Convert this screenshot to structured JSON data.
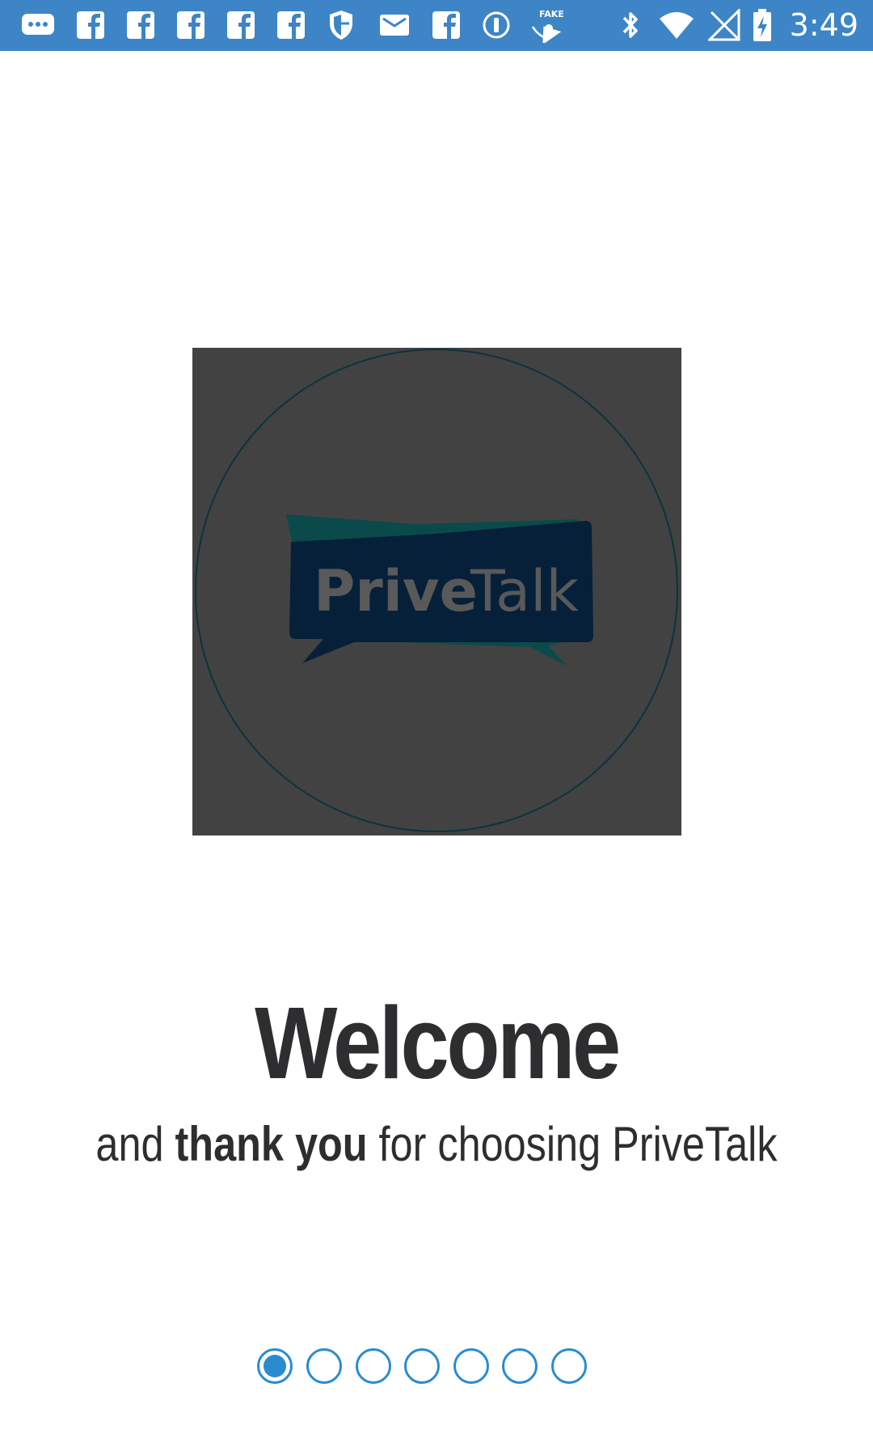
{
  "status_bar": {
    "time": "3:49",
    "left_icons": [
      "message-icon",
      "facebook-icon",
      "facebook-icon",
      "facebook-icon",
      "facebook-icon",
      "facebook-icon",
      "shield-icon",
      "mail-icon",
      "facebook-icon",
      "info-icon",
      "fake-gps-icon"
    ],
    "right_icons": [
      "bluetooth-icon",
      "wifi-icon",
      "signal-off-icon",
      "battery-charging-icon"
    ],
    "background_color": "#3d85c6"
  },
  "logo": {
    "text_bold": "Prive",
    "text_light": "Talk",
    "box_color": "#424242",
    "bubble_color": "#06203a",
    "accent_color": "#0b4a4a"
  },
  "welcome": {
    "title": "Welcome",
    "subtitle_before": "and ",
    "subtitle_bold": "thank you",
    "subtitle_after": " for choosing PriveTalk"
  },
  "pager": {
    "total_pages": 7,
    "current_page": 1,
    "color": "#2a8bcf"
  }
}
